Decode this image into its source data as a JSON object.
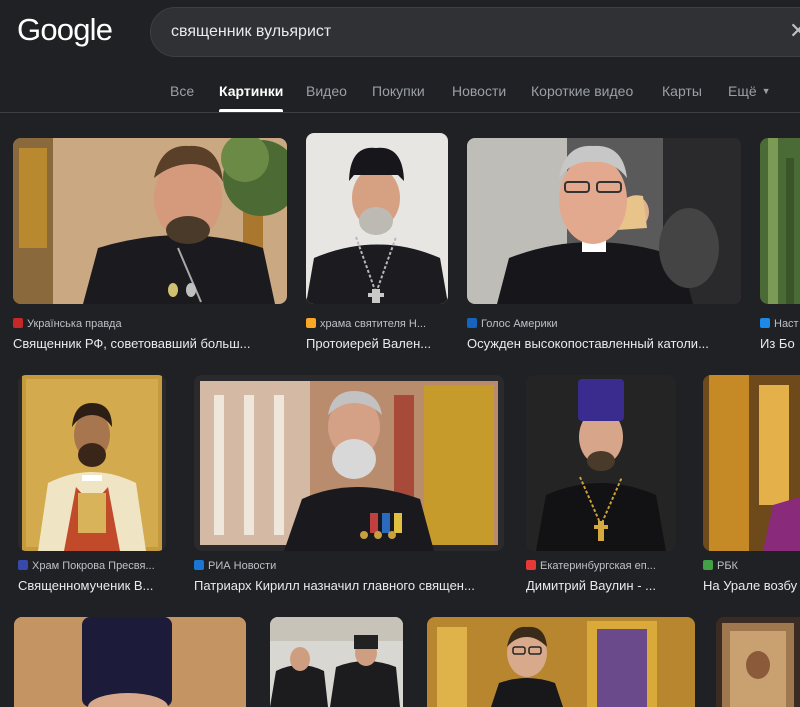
{
  "logo": "Google",
  "search": {
    "query": "священник вульярист"
  },
  "tabs": [
    "Все",
    "Картинки",
    "Видео",
    "Покупки",
    "Новости",
    "Короткие видео",
    "Карты",
    "Ещё"
  ],
  "results": [
    {
      "source": "Українська правда",
      "title": "Священник РФ, советовавший больш...",
      "favicon_color": "#c62828"
    },
    {
      "source": "храма святителя Н...",
      "title": "Протоиерей Вален...",
      "favicon_color": "#f9a825"
    },
    {
      "source": "Голос Америки",
      "title": "Осужден высокопоставленный католи...",
      "favicon_color": "#1565c0"
    },
    {
      "source": "Наст",
      "title": "Из Бо",
      "favicon_color": "#1e88e5"
    },
    {
      "source": "Храм Покрова Пресвя...",
      "title": "Священномученик В...",
      "favicon_color": "#3949ab"
    },
    {
      "source": "РИА Новости",
      "title": "Патриарх Кирилл назначил главного священ...",
      "favicon_color": "#1976d2"
    },
    {
      "source": "Екатеринбургская еп...",
      "title": "Димитрий Ваулин - ...",
      "favicon_color": "#e53935"
    },
    {
      "source": "РБК",
      "title": "На Урале возбу",
      "favicon_color": "#43a047"
    }
  ]
}
